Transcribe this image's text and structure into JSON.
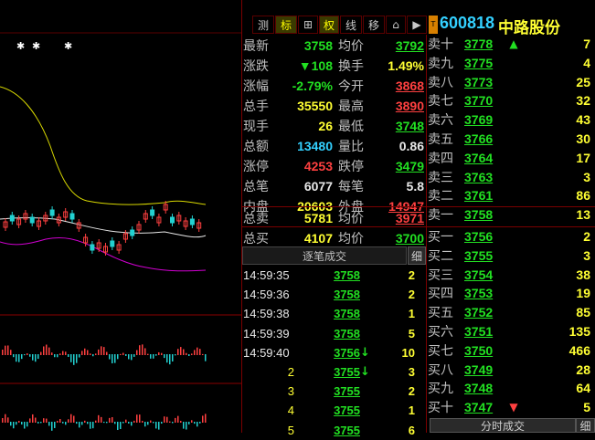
{
  "toolbar": {
    "buttons": [
      "测",
      "标",
      "⊞",
      "权",
      "线",
      "移",
      "⌂",
      "▶"
    ],
    "stock_code": "600818",
    "stock_name": "中路股份",
    "code_prefix_badge": "T"
  },
  "chart": {
    "markers": [
      "✱",
      "✱",
      "✱"
    ]
  },
  "quote": {
    "rows": [
      {
        "l1": "最新",
        "v1": "3758",
        "l2": "均价",
        "v2": "3792"
      },
      {
        "l1": "涨跌",
        "v1": "▼108",
        "l2": "换手",
        "v2": "1.49%"
      },
      {
        "l1": "涨幅",
        "v1": "-2.79%",
        "l2": "今开",
        "v2": "3868"
      },
      {
        "l1": "总手",
        "v1": "35550",
        "l2": "最高",
        "v2": "3890"
      },
      {
        "l1": "现手",
        "v1": "26",
        "l2": "最低",
        "v2": "3748"
      },
      {
        "l1": "总额",
        "v1": "13480",
        "l2": "量比",
        "v2": "0.86"
      },
      {
        "l1": "涨停",
        "v1": "4253",
        "l2": "跌停",
        "v2": "3479"
      },
      {
        "l1": "总笔",
        "v1": "6077",
        "l2": "每笔",
        "v2": "5.8"
      },
      {
        "l1": "内盘",
        "v1": "20603",
        "l2": "外盘",
        "v2": "14947"
      },
      {
        "l1": "总卖",
        "v1": "5781",
        "l2": "均价",
        "v2": "3971"
      },
      {
        "l1": "总买",
        "v1": "4107",
        "l2": "均价",
        "v2": "3700"
      }
    ]
  },
  "sell_orders": [
    {
      "label": "卖十",
      "price": "3778",
      "vol": "7",
      "arrow": "▲"
    },
    {
      "label": "卖九",
      "price": "3775",
      "vol": "4",
      "arrow": ""
    },
    {
      "label": "卖八",
      "price": "3773",
      "vol": "25",
      "arrow": ""
    },
    {
      "label": "卖七",
      "price": "3770",
      "vol": "32",
      "arrow": ""
    },
    {
      "label": "卖六",
      "price": "3769",
      "vol": "43",
      "arrow": ""
    },
    {
      "label": "卖五",
      "price": "3766",
      "vol": "30",
      "arrow": ""
    },
    {
      "label": "卖四",
      "price": "3764",
      "vol": "17",
      "arrow": ""
    },
    {
      "label": "卖三",
      "price": "3763",
      "vol": "3",
      "arrow": ""
    },
    {
      "label": "卖二",
      "price": "3761",
      "vol": "86",
      "arrow": ""
    },
    {
      "label": "卖一",
      "price": "3758",
      "vol": "13",
      "arrow": ""
    }
  ],
  "buy_orders": [
    {
      "label": "买一",
      "price": "3756",
      "vol": "2",
      "arrow": ""
    },
    {
      "label": "买二",
      "price": "3755",
      "vol": "3",
      "arrow": ""
    },
    {
      "label": "买三",
      "price": "3754",
      "vol": "38",
      "arrow": ""
    },
    {
      "label": "买四",
      "price": "3753",
      "vol": "19",
      "arrow": ""
    },
    {
      "label": "买五",
      "price": "3752",
      "vol": "85",
      "arrow": ""
    },
    {
      "label": "买六",
      "price": "3751",
      "vol": "135",
      "arrow": ""
    },
    {
      "label": "买七",
      "price": "3750",
      "vol": "466",
      "arrow": ""
    },
    {
      "label": "买八",
      "price": "3749",
      "vol": "28",
      "arrow": ""
    },
    {
      "label": "买九",
      "price": "3748",
      "vol": "64",
      "arrow": ""
    },
    {
      "label": "买十",
      "price": "3747",
      "vol": "5",
      "arrow": "▼"
    }
  ],
  "ticks": {
    "header": "逐笔成交",
    "detail_btn": "细",
    "rows": [
      {
        "time": "14:59:35",
        "price": "3758",
        "arrow": "",
        "vol": "2"
      },
      {
        "time": "14:59:36",
        "price": "3758",
        "arrow": "",
        "vol": "2"
      },
      {
        "time": "14:59:38",
        "price": "3758",
        "arrow": "",
        "vol": "1"
      },
      {
        "time": "14:59:39",
        "price": "3758",
        "arrow": "",
        "vol": "5"
      },
      {
        "time": "14:59:40",
        "price": "3756",
        "arrow": "↓",
        "vol": "10"
      },
      {
        "time": "2",
        "price": "3755",
        "arrow": "↓",
        "vol": "3"
      },
      {
        "time": "3",
        "price": "3755",
        "arrow": "",
        "vol": "2"
      },
      {
        "time": "4",
        "price": "3755",
        "arrow": "",
        "vol": "1"
      },
      {
        "time": "5",
        "price": "3755",
        "arrow": "",
        "vol": "6"
      }
    ]
  },
  "bottom": {
    "tab_label": "分时成交",
    "detail_btn": "细"
  }
}
